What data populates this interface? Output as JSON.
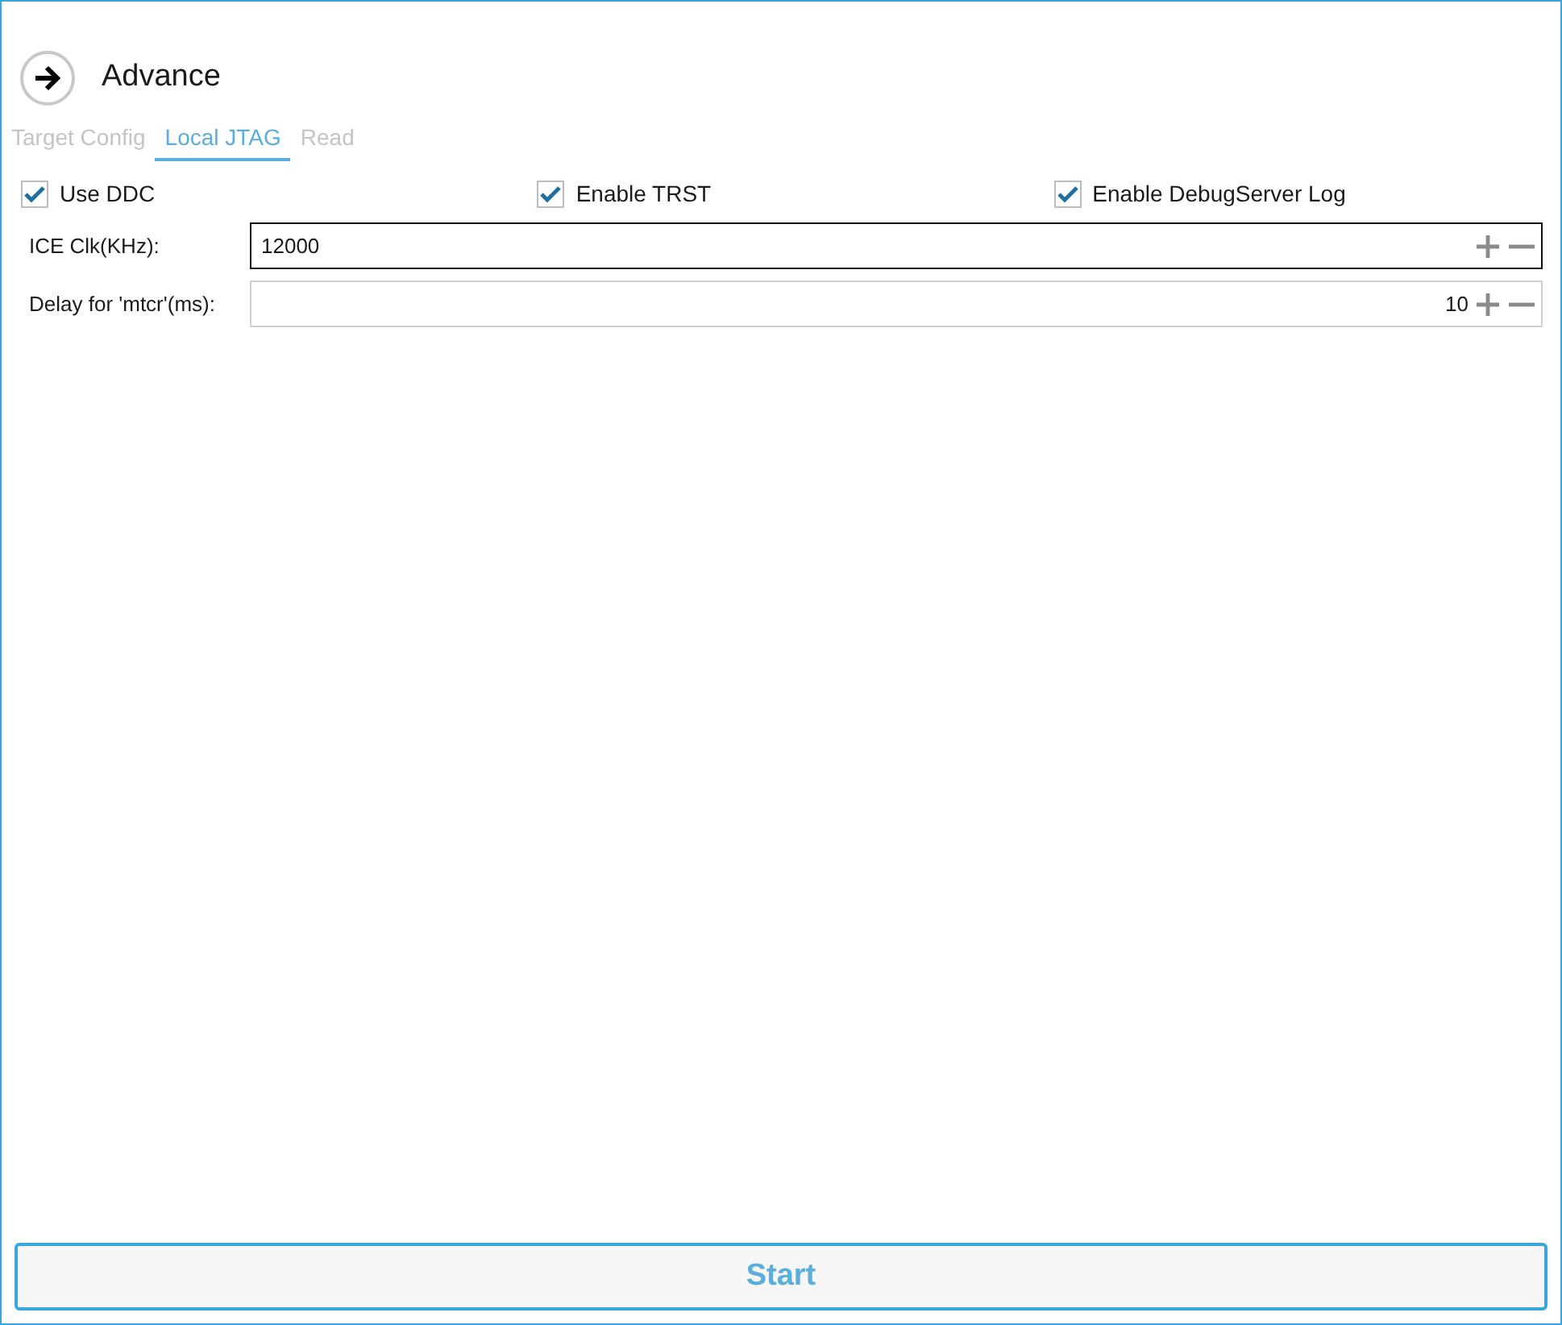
{
  "header": {
    "title": "Advance"
  },
  "tabs": [
    {
      "label": "Target Config",
      "selected": false
    },
    {
      "label": "Local JTAG",
      "selected": true
    },
    {
      "label": "Read",
      "selected": false
    }
  ],
  "checkboxes": [
    {
      "label": "Use DDC",
      "checked": true
    },
    {
      "label": "Enable TRST",
      "checked": true
    },
    {
      "label": "Enable DebugServer Log",
      "checked": true
    }
  ],
  "fields": [
    {
      "label": "ICE Clk(KHz):",
      "value": "12000",
      "focused": true
    },
    {
      "label": "Delay for 'mtcr'(ms):",
      "value": "10",
      "focused": false
    }
  ],
  "start_button": {
    "label": "Start"
  }
}
